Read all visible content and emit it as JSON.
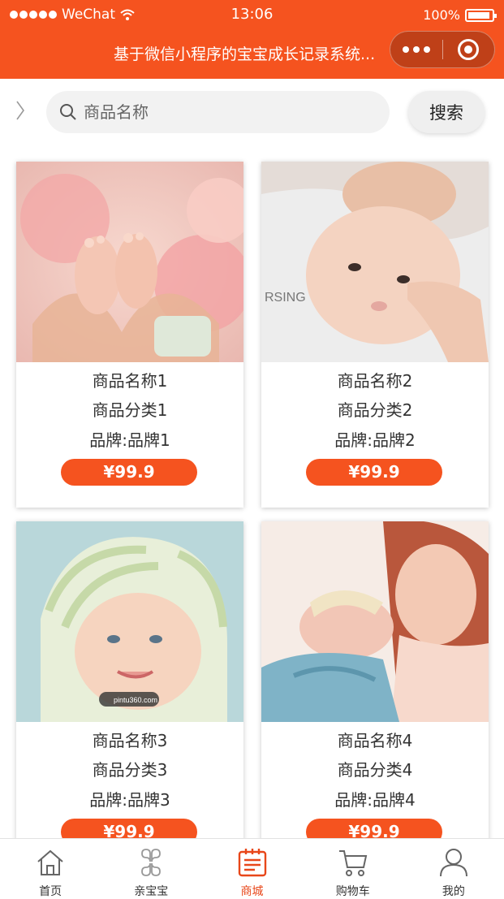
{
  "status_bar": {
    "carrier": "WeChat",
    "time": "13:06",
    "battery": "100%"
  },
  "nav": {
    "title": "基于微信小程序的宝宝成长记录系统..."
  },
  "search": {
    "placeholder": "商品名称",
    "button_label": "搜索"
  },
  "products": [
    {
      "name": "商品名称1",
      "category": "商品分类1",
      "brand": "品牌:品牌1",
      "price": "¥99.9"
    },
    {
      "name": "商品名称2",
      "category": "商品分类2",
      "brand": "品牌:品牌2",
      "price": "¥99.9"
    },
    {
      "name": "商品名称3",
      "category": "商品分类3",
      "brand": "品牌:品牌3",
      "price": "¥99.9"
    },
    {
      "name": "商品名称4",
      "category": "商品分类4",
      "brand": "品牌:品牌4",
      "price": "¥99.9"
    }
  ],
  "tabs": [
    {
      "label": "首页",
      "icon": "home-icon"
    },
    {
      "label": "亲宝宝",
      "icon": "clover-icon"
    },
    {
      "label": "商城",
      "icon": "calendar-icon",
      "active": true
    },
    {
      "label": "购物车",
      "icon": "cart-icon"
    },
    {
      "label": "我的",
      "icon": "user-icon"
    }
  ],
  "colors": {
    "accent": "#f5531f",
    "active_tab": "#e8471a"
  }
}
